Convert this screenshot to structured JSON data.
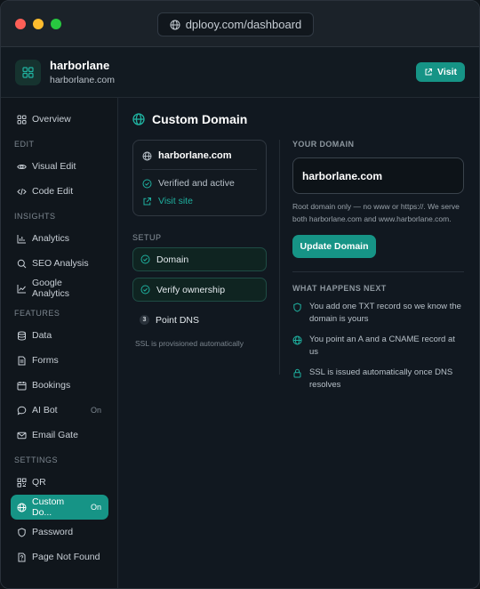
{
  "browser": {
    "url": "dplooy.com/dashboard"
  },
  "site": {
    "name": "harborlane",
    "url": "harborlane.com",
    "visit_label": "Visit"
  },
  "sidebar": {
    "overview": "Overview",
    "groups": [
      {
        "label": "EDIT",
        "items": [
          "Visual Edit",
          "Code Edit"
        ]
      },
      {
        "label": "INSIGHTS",
        "items": [
          "Analytics",
          "SEO Analysis",
          "Google Analytics"
        ]
      },
      {
        "label": "FEATURES",
        "items": [
          "Data",
          "Forms",
          "Bookings",
          "AI Bot",
          "Email Gate"
        ]
      },
      {
        "label": "SETTINGS",
        "items": [
          "QR",
          "Custom Do...",
          "Password",
          "Page Not Found"
        ]
      }
    ],
    "ai_bot_badge": "On",
    "custom_domain_badge": "On"
  },
  "page": {
    "title": "Custom Domain",
    "card": {
      "domain": "harborlane.com",
      "status": "Verified and active",
      "link": "Visit site"
    },
    "setup_label": "SETUP",
    "steps": [
      "Domain",
      "Verify ownership",
      "Point DNS"
    ],
    "step3_num": "3",
    "ssl_note": "SSL is provisioned automatically",
    "your_domain_label": "YOUR DOMAIN",
    "domain_value": "harborlane.com",
    "help": "Root domain only — no www or https://. We serve both harborlane.com and www.harborlane.com.",
    "update_label": "Update Domain",
    "next_label": "WHAT HAPPENS NEXT",
    "next_items": [
      "You add one TXT record so we know the domain is yours",
      "You point an A and a CNAME record at us",
      "SSL is issued automatically once DNS resolves"
    ]
  },
  "colors": {
    "accent": "#169486",
    "link": "#1fb09f"
  }
}
